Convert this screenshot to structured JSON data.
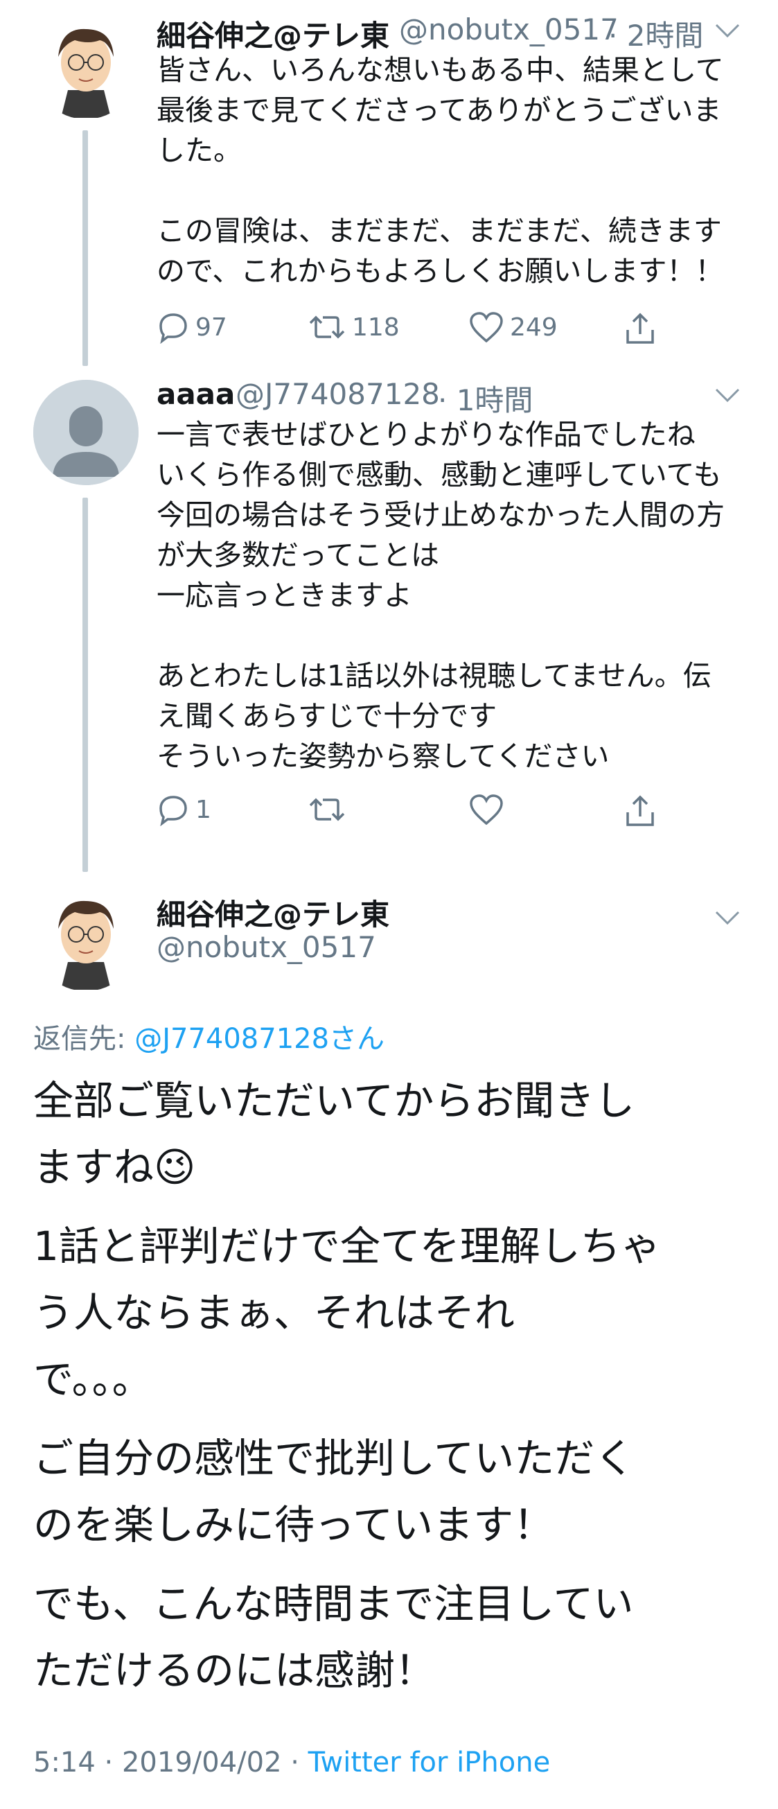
{
  "tweet1": {
    "name": "細谷伸之@テレ東",
    "handle": "@nobutx_0517",
    "time": "· 2時間",
    "text": "皆さん、いろんな想いもある中、結果として\n最後まで見てくださってありがとうございま\nした。\n\nこの冒険は、まだまだ、まだまだ、続きます\nので、これからもよろしくお願いします！！",
    "replies": "97",
    "retweets": "118",
    "likes": "249"
  },
  "tweet2": {
    "name": "aaaa",
    "handle": "@J774087128",
    "time": "· 1時間",
    "text": "一言で表せばひとりよがりな作品でしたね\nいくら作る側で感動、感動と連呼していても\n今回の場合はそう受け止めなかった人間の方\nが大多数だってことは\n一応言っときますよ\n\nあとわたしは1話以外は視聴してません。伝\nえ聞くあらすじで十分です\nそういった姿勢から察してください",
    "replies": "1"
  },
  "main_tweet": {
    "name": "細谷伸之@テレ東",
    "handle": "@nobutx_0517",
    "reply_prefix": "返信先: ",
    "reply_target": "@J774087128さん",
    "paragraphs": [
      "全部ご覧いただいてからお聞きし\nますね😉",
      "1話と評判だけで全てを理解しちゃ\nう人ならまぁ、それはそれ\nで。。。",
      "ご自分の感性で批判していただく\nのを楽しみに待っています！",
      "でも、こんな時間まで注目してい\nただけるのには感謝！"
    ],
    "timestamp": "5:14 · 2019/04/02 · ",
    "source": "Twitter for iPhone"
  },
  "colors": {
    "text": "#14171a",
    "secondary": "#657786",
    "link": "#1da1f2",
    "thread_line": "#c4cfd6"
  }
}
